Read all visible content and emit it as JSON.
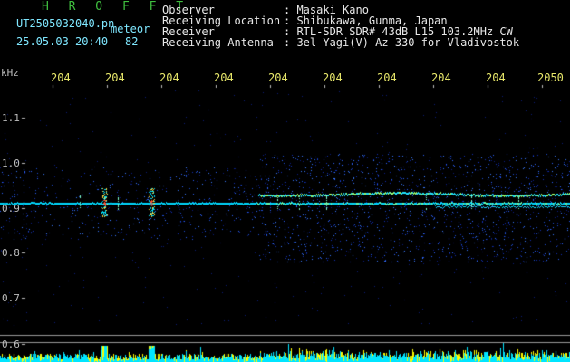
{
  "header": {
    "title": "H R O F F T",
    "filename": "UT2505032040.pn",
    "tag": "meteor",
    "datetime": "25.05.03 20:40",
    "count": "82",
    "fields": [
      {
        "label": "Observer",
        "value": ": Masaki Kano"
      },
      {
        "label": "Receiving Location",
        "value": ": Shibukawa, Gunma, Japan"
      },
      {
        "label": "Receiver",
        "value": ": RTL-SDR SDR# 43dB L15 103.2MHz CW"
      },
      {
        "label": "Receiving Antenna",
        "value": ": 3el Yagi(V) Az 330 for Vladivostok"
      }
    ]
  },
  "axis": {
    "unit": "kHz",
    "x_ticks": [
      "204",
      "204",
      "204",
      "204",
      "204",
      "204",
      "204",
      "204",
      "204",
      "2050"
    ],
    "y_ticks": [
      "1.1",
      "1.0",
      "0.9",
      "0.8",
      "0.7",
      "0.6"
    ]
  },
  "colors": {
    "background": "#000000",
    "header_title": "#3fbf3f",
    "header_text": "#7fe7ff",
    "field_text": "#e8e8e8",
    "x_tick_text": "#e7e76a",
    "signal_cyan": "#00e5ff",
    "noise_blue": "#1f4fd8",
    "bar_yellow": "#ffff00"
  }
}
